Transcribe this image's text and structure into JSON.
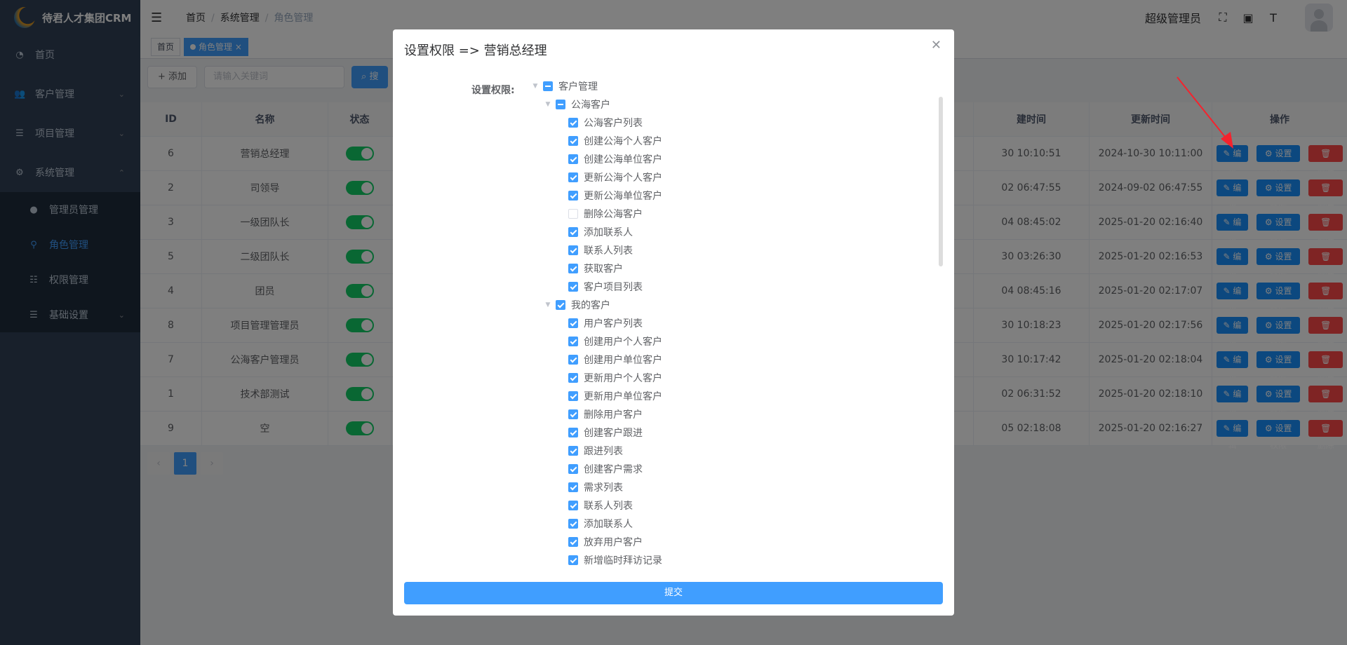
{
  "app": {
    "title": "待君人才集团CRM"
  },
  "sidebar": {
    "items": [
      {
        "label": "首页"
      },
      {
        "label": "客户管理"
      },
      {
        "label": "项目管理"
      },
      {
        "label": "系统管理"
      },
      {
        "label": "管理员管理"
      },
      {
        "label": "角色管理"
      },
      {
        "label": "权限管理"
      },
      {
        "label": "基础设置"
      }
    ]
  },
  "header": {
    "breadcrumb": [
      "首页",
      "系统管理",
      "角色管理"
    ],
    "user": "超级管理员"
  },
  "tabs": [
    "首页",
    "角色管理"
  ],
  "toolbar": {
    "add": "+ 添加",
    "search_placeholder": "请输入关键词",
    "search": "搜"
  },
  "table": {
    "headers": {
      "id": "ID",
      "name": "名称",
      "status": "状态",
      "create": "建时间",
      "update": "更新时间",
      "op": "操作"
    },
    "rows": [
      {
        "id": "6",
        "name": "营销总经理",
        "create": "30 10:10:51",
        "update": "2024-10-30 10:11:00"
      },
      {
        "id": "2",
        "name": "司领导",
        "create": "02 06:47:55",
        "update": "2024-09-02 06:47:55"
      },
      {
        "id": "3",
        "name": "一级团队长",
        "create": "04 08:45:02",
        "update": "2025-01-20 02:16:40"
      },
      {
        "id": "5",
        "name": "二级团队长",
        "create": "30 03:26:30",
        "update": "2025-01-20 02:16:53"
      },
      {
        "id": "4",
        "name": "团员",
        "create": "04 08:45:16",
        "update": "2025-01-20 02:17:07"
      },
      {
        "id": "8",
        "name": "项目管理管理员",
        "create": "30 10:18:23",
        "update": "2025-01-20 02:17:56"
      },
      {
        "id": "7",
        "name": "公海客户管理员",
        "create": "30 10:17:42",
        "update": "2025-01-20 02:18:04"
      },
      {
        "id": "1",
        "name": "技术部测试",
        "create": "02 06:31:52",
        "update": "2025-01-20 02:18:10"
      },
      {
        "id": "9",
        "name": "空",
        "create": "05 02:18:08",
        "update": "2025-01-20 02:16:27"
      }
    ],
    "ops": {
      "edit": "编辑",
      "perm": "设置权限",
      "del": "删除"
    }
  },
  "pager": {
    "current": "1"
  },
  "dialog": {
    "title": "设置权限 => 营销总经理",
    "label": "设置权限:",
    "submit": "提交",
    "tree": [
      {
        "label": "客户管理",
        "state": "ind",
        "level": 1,
        "caret": true
      },
      {
        "label": "公海客户",
        "state": "ind",
        "level": 2,
        "caret": true
      },
      {
        "label": "公海客户列表",
        "state": "chk",
        "level": 3
      },
      {
        "label": "创建公海个人客户",
        "state": "chk",
        "level": 3
      },
      {
        "label": "创建公海单位客户",
        "state": "chk",
        "level": 3
      },
      {
        "label": "更新公海个人客户",
        "state": "chk",
        "level": 3
      },
      {
        "label": "更新公海单位客户",
        "state": "chk",
        "level": 3
      },
      {
        "label": "删除公海客户",
        "state": "un",
        "level": 3
      },
      {
        "label": "添加联系人",
        "state": "chk",
        "level": 3
      },
      {
        "label": "联系人列表",
        "state": "chk",
        "level": 3
      },
      {
        "label": "获取客户",
        "state": "chk",
        "level": 3
      },
      {
        "label": "客户项目列表",
        "state": "chk",
        "level": 3
      },
      {
        "label": "我的客户",
        "state": "chk",
        "level": 2,
        "caret": true
      },
      {
        "label": "用户客户列表",
        "state": "chk",
        "level": 3
      },
      {
        "label": "创建用户个人客户",
        "state": "chk",
        "level": 3
      },
      {
        "label": "创建用户单位客户",
        "state": "chk",
        "level": 3
      },
      {
        "label": "更新用户个人客户",
        "state": "chk",
        "level": 3
      },
      {
        "label": "更新用户单位客户",
        "state": "chk",
        "level": 3
      },
      {
        "label": "删除用户客户",
        "state": "chk",
        "level": 3
      },
      {
        "label": "创建客户跟进",
        "state": "chk",
        "level": 3
      },
      {
        "label": "跟进列表",
        "state": "chk",
        "level": 3
      },
      {
        "label": "创建客户需求",
        "state": "chk",
        "level": 3
      },
      {
        "label": "需求列表",
        "state": "chk",
        "level": 3
      },
      {
        "label": "联系人列表",
        "state": "chk",
        "level": 3
      },
      {
        "label": "添加联系人",
        "state": "chk",
        "level": 3
      },
      {
        "label": "放弃用户客户",
        "state": "chk",
        "level": 3
      },
      {
        "label": "新增临时拜访记录",
        "state": "chk",
        "level": 3
      }
    ]
  },
  "colors": {
    "primary": "#409eff",
    "sidebar": "#304156",
    "danger": "#ff4949",
    "switch": "#13ce66"
  }
}
